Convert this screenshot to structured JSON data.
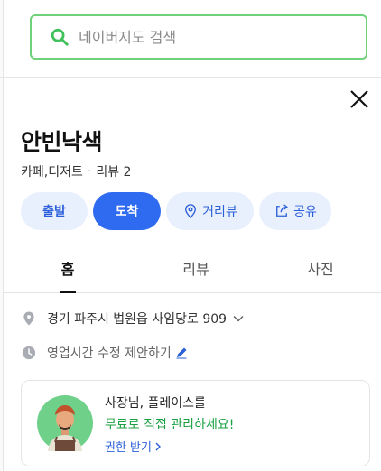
{
  "search": {
    "placeholder": "네이버지도 검색"
  },
  "place": {
    "name": "안빈낙색",
    "category": "카페,디저트",
    "review_label": "리뷰 2"
  },
  "actions": {
    "depart": "출발",
    "arrive": "도착",
    "distance": "거리뷰",
    "share": "공유"
  },
  "tabs": [
    "홈",
    "리뷰",
    "사진"
  ],
  "info": {
    "address": "경기 파주시 법원읍 사임당로 909",
    "hours": "영업시간 수정 제안하기"
  },
  "owner_card": {
    "line1": "사장님, 플레이스를",
    "line2": "무료로 직접 관리하세요!",
    "link": "권한 받기"
  },
  "colors": {
    "search_border": "#6fd27b",
    "primary": "#2f6bf0",
    "action_bg": "#e9f0fd",
    "green_text": "#1aa142"
  }
}
